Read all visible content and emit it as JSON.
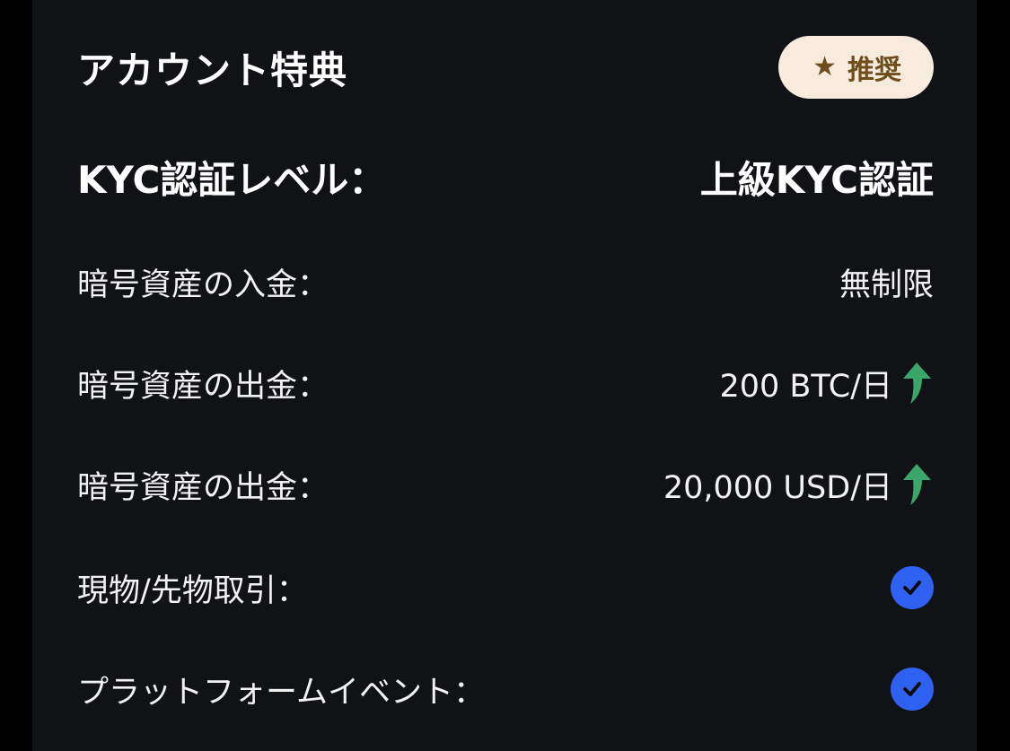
{
  "header": {
    "title": "アカウント特典",
    "badge_label": "推奨",
    "badge_icon": "star-icon"
  },
  "level": {
    "label": "KYC認証レベル：",
    "value": "上級KYC認証"
  },
  "benefits": [
    {
      "label": "暗号資産の入金：",
      "value": "無制限"
    },
    {
      "label": "暗号資産の出金：",
      "value": "200 BTC/日",
      "icon": "up-arrow-icon"
    },
    {
      "label": "暗号資産の出金：",
      "value": "20,000 USD/日",
      "icon": "up-arrow-icon"
    },
    {
      "label": "現物/先物取引：",
      "icon": "check-circle-icon"
    },
    {
      "label": "プラットフォームイベント：",
      "icon": "check-circle-icon"
    }
  ],
  "colors": {
    "background": "#111216",
    "badge_background": "#f6ebdc",
    "badge_text": "#6f4e1e",
    "up_arrow": "#3aa66a",
    "check_circle": "#2f61f0"
  }
}
